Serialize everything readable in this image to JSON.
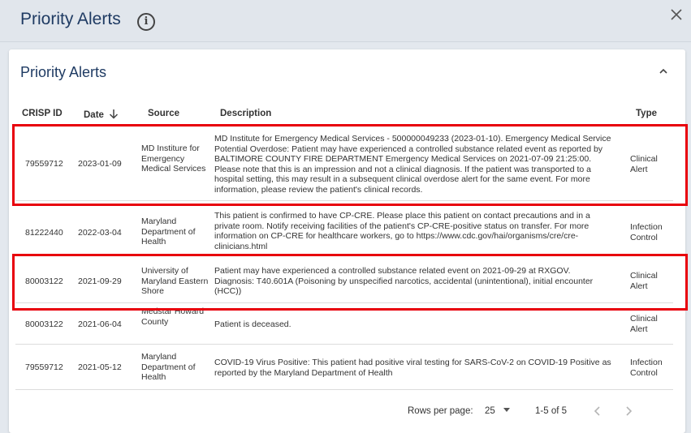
{
  "window": {
    "title": "Priority Alerts"
  },
  "card": {
    "title": "Priority Alerts"
  },
  "table": {
    "columns": {
      "id": "CRISP ID",
      "date": "Date",
      "source": "Source",
      "description": "Description",
      "type": "Type"
    },
    "rows": [
      {
        "id": "79559712",
        "date": "2023-01-09",
        "source": "MD Institure for Emergency Medical Services",
        "description": "MD Institute for Emergency Medical Services - 500000049233 (2023-01-10). Emergency Medical Service Potential Overdose: Patient may have experienced a controlled substance related event as reported by BALTIMORE COUNTY FIRE DEPARTMENT Emergency Medical Services on 2021-07-09 21:25:00. Please note that this is an impression and not a clinical diagnosis. If the patient was transported to a hospital setting, this may result in a subsequent clinical overdose alert for the same event. For more information, please review the patient's clinical records.",
        "type": "Clinical Alert"
      },
      {
        "id": "81222440",
        "date": "2022-03-04",
        "source": "Maryland Department of Health",
        "description": "This patient is confirmed to have CP-CRE. Please place this patient on contact precautions and in a private room. Notify receiving facilities of the patient's CP-CRE-positive status on transfer. For more information on CP-CRE for healthcare workers, go to https://www.cdc.gov/hai/organisms/cre/cre-clinicians.html",
        "type": "Infection Control"
      },
      {
        "id": "80003122",
        "date": "2021-09-29",
        "source": "University of Maryland Eastern Shore",
        "description": "Patient may have experienced a controlled substance related event on 2021-09-29 at RXGOV. Diagnosis: T40.601A (Poisoning by unspecified narcotics, accidental (unintentional), initial encounter (HCC))",
        "type": "Clinical Alert"
      },
      {
        "id": "80003122",
        "date": "2021-06-04",
        "source": "Medstar Howard County",
        "description": "Patient is deceased.",
        "type": "Clinical Alert"
      },
      {
        "id": "79559712",
        "date": "2021-05-12",
        "source": "Maryland Department of Health",
        "description": "COVID-19 Virus Positive: This patient had positive viral testing for SARS-CoV-2 on COVID-19 Positive as reported by the Maryland Department of Health",
        "type": "Infection Control"
      }
    ]
  },
  "pagination": {
    "rows_label": "Rows per page:",
    "rows_value": "25",
    "range": "1-5 of 5"
  },
  "colors": {
    "title": "#1f3b63",
    "highlight": "#e8000c",
    "background": "#e3e8ee"
  },
  "icons": {
    "info": "info-circle-icon",
    "close": "close-icon",
    "collapse": "chevron-up-icon",
    "sort": "arrow-down-icon",
    "prev": "chevron-left-icon",
    "next": "chevron-right-icon"
  }
}
